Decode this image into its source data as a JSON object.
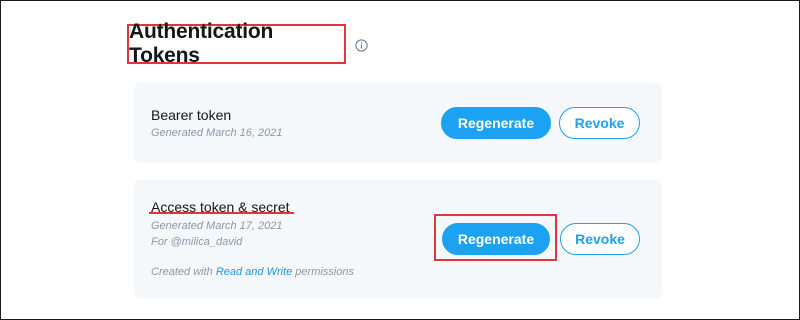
{
  "page": {
    "title": "Authentication Tokens",
    "info_icon": "info-circle-icon"
  },
  "tokens": [
    {
      "name": "Bearer token",
      "generated": "Generated March 16, 2021",
      "regenerate_label": "Regenerate",
      "revoke_label": "Revoke"
    },
    {
      "name": "Access token & secret",
      "generated": "Generated March 17, 2021",
      "for_user": "For @milica_david",
      "permissions_prefix": "Created with ",
      "permissions_link": "Read and Write",
      "permissions_suffix": " permissions",
      "regenerate_label": "Regenerate",
      "revoke_label": "Revoke"
    }
  ],
  "colors": {
    "accent": "#1da1f2",
    "annotation": "#e5333b",
    "card_bg": "#f5f8fa",
    "muted_text": "#8899a6"
  }
}
